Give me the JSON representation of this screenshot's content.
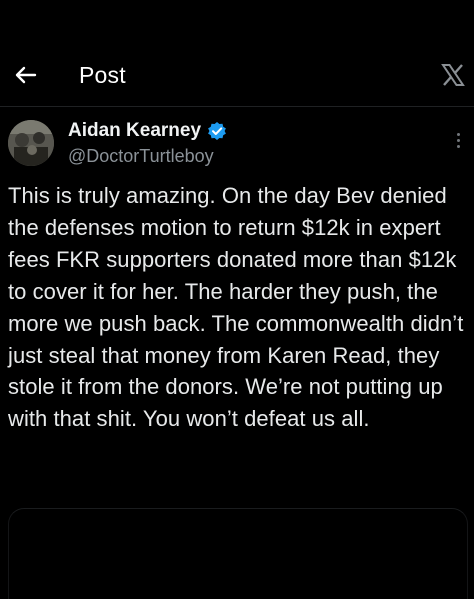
{
  "header": {
    "title": "Post",
    "back_icon": "arrow-left-icon",
    "logo_icon": "x-logo-icon"
  },
  "author": {
    "name": "Aidan Kearney",
    "handle": "@DoctorTurtleboy",
    "verified": true,
    "verified_color": "#1d9bf0"
  },
  "post": {
    "text": "This is truly amazing. On the day Bev denied the defenses motion to return $12k in expert fees FKR supporters donated more than $12k to cover it for her. The harder they push, the more we push back. The commonwealth didn’t just steal that money from Karen Read, they stole it from the donors. We’re not putting up with that shit. You won’t defeat us all."
  },
  "colors": {
    "background": "#000000",
    "text": "#e7e9ea",
    "secondary_text": "#8b9298"
  }
}
